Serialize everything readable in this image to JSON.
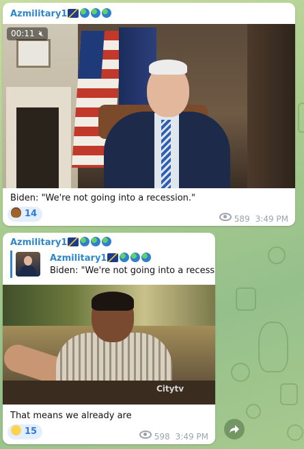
{
  "messages": [
    {
      "sender": "Azmilitary1",
      "sender_emoji": [
        "flag-icon",
        "globe-icon",
        "globe-icon",
        "globe-icon"
      ],
      "video_duration": "00:11",
      "caption": "Biden: \"We're not going into a recession.\"",
      "reaction": {
        "emoji": "poop-emoji",
        "count": "14"
      },
      "views": "589",
      "time": "3:49 PM"
    },
    {
      "sender": "Azmilitary1",
      "sender_emoji": [
        "flag-icon",
        "globe-icon",
        "globe-icon",
        "globe-icon"
      ],
      "reply": {
        "sender": "Azmilitary1",
        "text": "Biden: \"We're not going into a recessi..."
      },
      "video_watermark": "Citytv",
      "caption": "That means we already are",
      "reaction": {
        "emoji": "grinning-emoji",
        "count": "15"
      },
      "views": "598",
      "time": "3:49 PM"
    }
  ],
  "colors": {
    "accent": "#2f86c9",
    "reaction_bg": "#e3efff",
    "meta": "#9aa3ad",
    "chat_bg": "#a9cb8e"
  }
}
